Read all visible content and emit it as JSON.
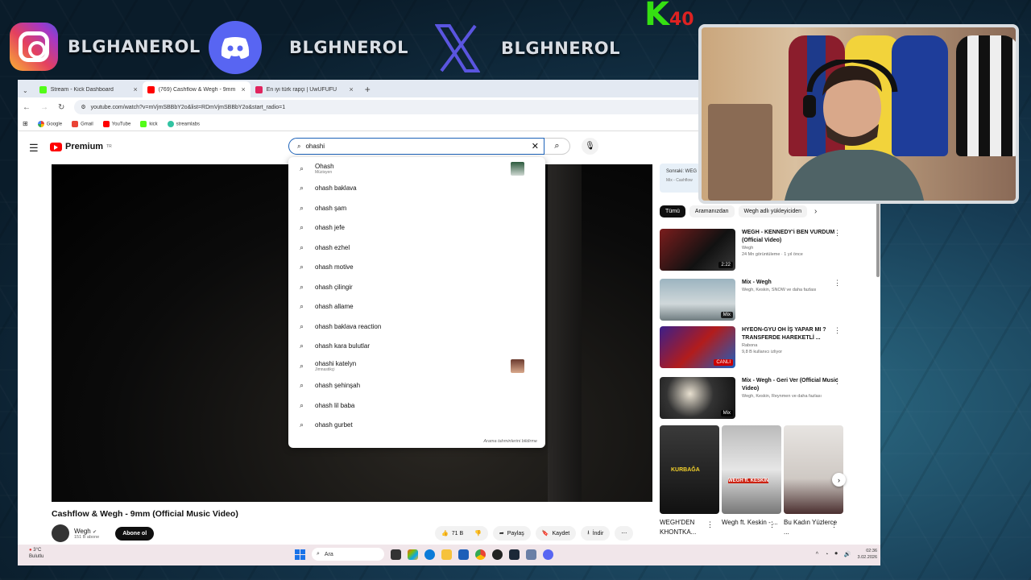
{
  "overlay": {
    "instagram_name": "BLGHANEROL",
    "discord_name": "BLGHNEROL",
    "x_name": "BLGHNEROL",
    "badge_letter": "K",
    "badge_number": "40"
  },
  "browser": {
    "tabs": [
      {
        "label": "Stream - Kick Dashboard",
        "color": "#53fc18"
      },
      {
        "label": "(769) Cashflow & Wegh - 9mm",
        "color": "#ff0000"
      },
      {
        "label": "En iyi türk rapçi | UwUFUFU",
        "color": "#e0245e"
      }
    ],
    "url": "youtube.com/watch?v=mVjmSBBbY2o&list=RDmVjmSBBbY2o&start_radio=1",
    "bookmarks": [
      "Google",
      "Gmail",
      "YouTube",
      "kick",
      "streamlabs"
    ]
  },
  "youtube": {
    "logo_text": "Premium",
    "logo_region": "TR",
    "search_value": "ohashi",
    "suggestions": [
      {
        "text": "Ohash",
        "sub": "Müzisyen",
        "thumb": true
      },
      {
        "text": "ohash baklava"
      },
      {
        "text": "ohash şam"
      },
      {
        "text": "ohash jefe"
      },
      {
        "text": "ohash ezhel"
      },
      {
        "text": "ohash motive"
      },
      {
        "text": "ohash çilingir"
      },
      {
        "text": "ohash allame"
      },
      {
        "text": "ohash baklava reaction"
      },
      {
        "text": "ohash kara bulutlar"
      },
      {
        "text": "ohashi katelyn",
        "sub": "Jimnastikçi",
        "thumb": true
      },
      {
        "text": "ohash şehinşah"
      },
      {
        "text": "ohash lil baba"
      },
      {
        "text": "ohash gurbet"
      }
    ],
    "suggestion_footer": "Arama tahminlerini bildirme",
    "video_title": "Cashflow & Wegh - 9mm (Official Music Video)",
    "channel_name": "Wegh",
    "channel_subs": "151 B abone",
    "subscribe_label": "Abone ol",
    "actions": {
      "likes": "71 B",
      "share": "Paylaş",
      "save": "Kaydet",
      "download": "İndir"
    },
    "next_label": "Sonraki: WEG",
    "next_sub": "Mix - Cashflow",
    "chips": [
      "Tümü",
      "Aramanızdan",
      "Wegh adlı yükleyiciden"
    ],
    "recommendations": [
      {
        "title": "WEGH - KENNEDY'i BEN VURDUM (Official Video)",
        "channel": "Wegh",
        "meta": "24 Mn görüntüleme · 1 yıl önce",
        "badge": "2:22"
      },
      {
        "title": "Mix - Wegh",
        "channel": "Wegh, Keskin, SNOW ve daha fazlası",
        "meta": "",
        "badge": "Mix"
      },
      {
        "title": "HYEON-GYU OH İŞ YAPAR MI ? TRANSFERDE HAREKETLİ ...",
        "channel": "Rabona",
        "meta": "9,8 B kullanıcı izliyor",
        "badge": "CANLI"
      },
      {
        "title": "Mix - Wegh - Geri Ver (Official Music Video)",
        "channel": "Wegh, Keskin, Reynmen ve daha fazlası",
        "meta": "",
        "badge": "Mix"
      }
    ],
    "shorts": [
      {
        "title": "WEGH'DEN KHONTKA...",
        "overlay": "KURBAĞA"
      },
      {
        "title": "Wegh ft. Keskin - ...",
        "overlay": "WEGH ft. KESKİN"
      },
      {
        "title": "Bu Kadın Yüzlerce ...",
        "overlay": ""
      }
    ]
  },
  "taskbar": {
    "weather_temp": "3°C",
    "weather_desc": "Bulutlu",
    "search_label": "Ara",
    "time": "02:36",
    "date": "3.02.2026"
  }
}
